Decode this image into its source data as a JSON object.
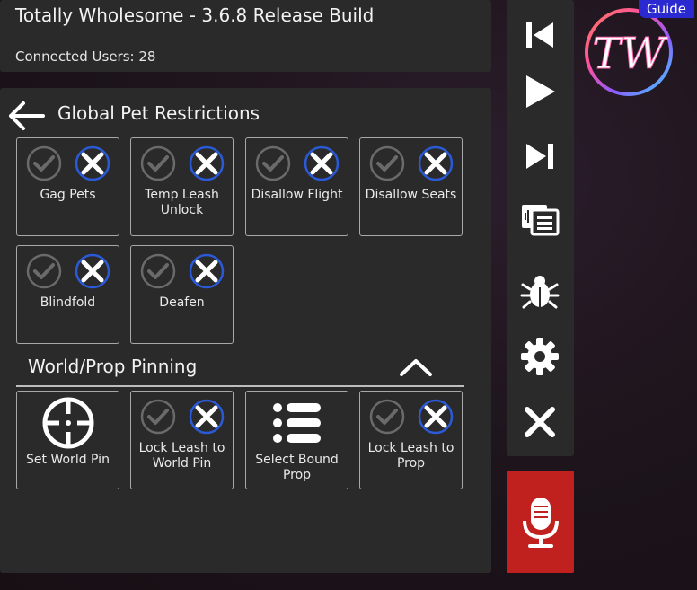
{
  "header": {
    "title": "Totally Wholesome - 3.6.8 Release Build",
    "connected_users": "Connected Users: 28"
  },
  "restrictions": {
    "title": "Global Pet Restrictions",
    "tiles": [
      {
        "label": "Gag Pets"
      },
      {
        "label": "Temp Leash Unlock"
      },
      {
        "label": "Disallow Flight"
      },
      {
        "label": "Disallow Seats"
      },
      {
        "label": "Blindfold"
      },
      {
        "label": "Deafen"
      }
    ]
  },
  "pinning": {
    "title": "World/Prop Pinning",
    "tiles": [
      {
        "label": "Set World Pin",
        "icon": "crosshair-icon"
      },
      {
        "label": "Lock Leash to World Pin"
      },
      {
        "label": "Select Bound Prop",
        "icon": "list-icon"
      },
      {
        "label": "Lock Leash to Prop"
      }
    ]
  },
  "guide_label": "Guide",
  "logo_text": "TW",
  "sidebar": [
    "previous-track-icon",
    "play-icon",
    "next-track-icon",
    "transcript-icon",
    "bug-icon",
    "gear-icon",
    "close-icon"
  ],
  "mic": "microphone-icon",
  "colors": {
    "panel": "#2a2a2a",
    "accent_blue": "#2a2ad0",
    "mic_red": "#c0201e",
    "tile_border": "#a8a8a8"
  }
}
